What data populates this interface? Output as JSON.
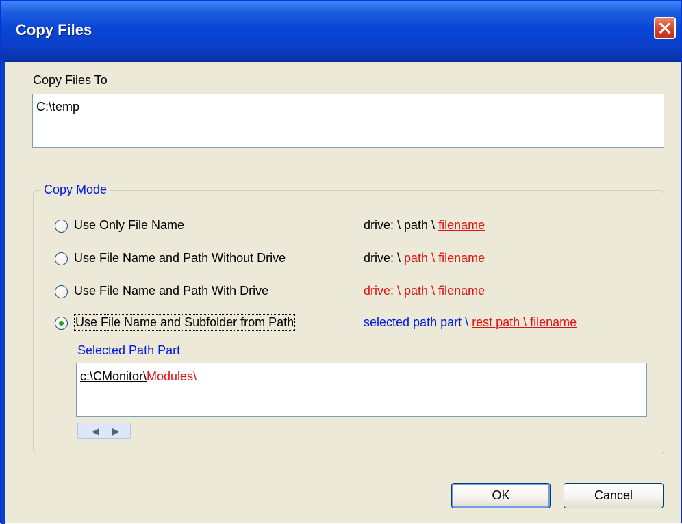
{
  "window": {
    "title": "Copy Files"
  },
  "copy_to": {
    "label": "Copy Files To",
    "value": "C:\\temp"
  },
  "copy_mode": {
    "legend": "Copy Mode",
    "options": [
      {
        "label": "Use Only File Name",
        "selected": false,
        "example": {
          "plain": "drive: \\ path \\ ",
          "highlight": "filename"
        }
      },
      {
        "label": "Use File Name and Path Without Drive",
        "selected": false,
        "example": {
          "plain": "drive: \\ ",
          "highlight": "path \\ filename"
        }
      },
      {
        "label": "Use File Name and Path With Drive",
        "selected": false,
        "example": {
          "plain": "",
          "highlight": "drive: \\ path \\ filename"
        }
      },
      {
        "label": "Use File Name and Subfolder from Path",
        "selected": true,
        "example": {
          "blue": "selected path part \\ ",
          "highlight": "rest path \\ filename"
        }
      }
    ],
    "selected_path": {
      "label": "Selected Path Part",
      "selected_part": "c:\\CMonitor\\",
      "rest_part": "Modules\\"
    }
  },
  "buttons": {
    "ok": "OK",
    "cancel": "Cancel"
  },
  "colors": {
    "title_bar": "#0a46d6",
    "highlight": "#e21111",
    "accent_blue": "#0019e0",
    "radio_selected": "#21a121"
  }
}
